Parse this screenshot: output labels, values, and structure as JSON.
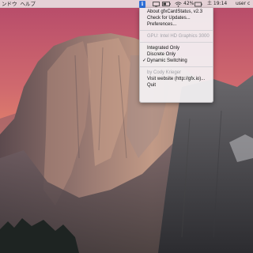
{
  "menubar": {
    "left_items": [
      "ンドウ",
      "ヘルプ"
    ],
    "gfx_icon": "i",
    "status_icons": [
      "gfxcardstatus-icon",
      "display-icon",
      "battery-icon",
      "wifi-icon",
      "volume-icon"
    ],
    "battery_percent": "42%",
    "time": "土 19:14",
    "user": "user c"
  },
  "menu": {
    "about": "About gfxCardStatus, v2.3",
    "check_updates": "Check for Updates...",
    "preferences": "Preferences...",
    "gpu_status": "GPU: Intel HD Graphics 3000",
    "integrated_only": "Integrated Only",
    "discrete_only": "Discrete Only",
    "dynamic_switching": "Dynamic Switching",
    "checkmark": "✓",
    "author": "by Cody Krieger",
    "visit_website": "Visit website (http://gfx.io)...",
    "quit": "Quit"
  },
  "colors": {
    "menubar_bg": "#ece8e8",
    "menu_bg": "#f4f2f4",
    "disabled_text": "#a2a2a8",
    "icon_blue": "#2f6fd6"
  }
}
